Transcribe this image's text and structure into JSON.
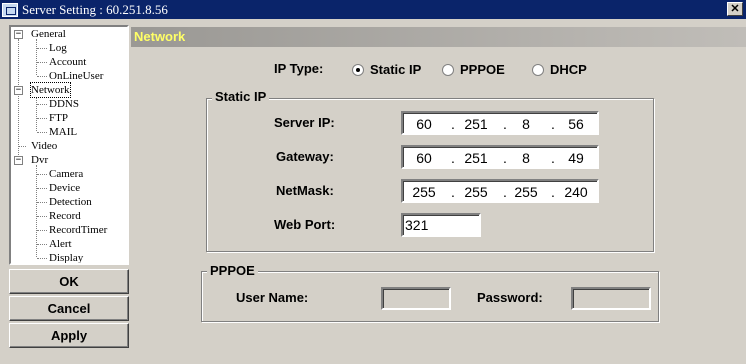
{
  "window": {
    "title": "Server Setting : 60.251.8.56"
  },
  "tree": {
    "items": [
      {
        "label": "General"
      },
      {
        "label": "Log"
      },
      {
        "label": "Account"
      },
      {
        "label": "OnLineUser"
      },
      {
        "label": "Network"
      },
      {
        "label": "DDNS"
      },
      {
        "label": "FTP"
      },
      {
        "label": "MAIL"
      },
      {
        "label": "Video"
      },
      {
        "label": "Dvr"
      },
      {
        "label": "Camera"
      },
      {
        "label": "Device"
      },
      {
        "label": "Detection"
      },
      {
        "label": "Record"
      },
      {
        "label": "RecordTimer"
      },
      {
        "label": "Alert"
      },
      {
        "label": "Display"
      }
    ],
    "selected": "Network"
  },
  "buttons": {
    "ok": "OK",
    "cancel": "Cancel",
    "apply": "Apply"
  },
  "panel": {
    "title": "Network"
  },
  "ip_type": {
    "label": "IP Type:",
    "options": [
      {
        "label": "Static IP",
        "selected": true
      },
      {
        "label": "PPPOE",
        "selected": false
      },
      {
        "label": "DHCP",
        "selected": false
      }
    ]
  },
  "static_ip": {
    "group_label": "Static IP",
    "server_ip": {
      "label": "Server IP:",
      "octets": [
        "60",
        "251",
        "8",
        "56"
      ]
    },
    "gateway": {
      "label": "Gateway:",
      "octets": [
        "60",
        "251",
        "8",
        "49"
      ]
    },
    "netmask": {
      "label": "NetMask:",
      "octets": [
        "255",
        "255",
        "255",
        "240"
      ]
    },
    "web_port": {
      "label": "Web Port:",
      "value": "321"
    }
  },
  "pppoe": {
    "group_label": "PPPOE",
    "user_name": {
      "label": "User Name:",
      "value": ""
    },
    "password": {
      "label": "Password:",
      "value": ""
    }
  }
}
